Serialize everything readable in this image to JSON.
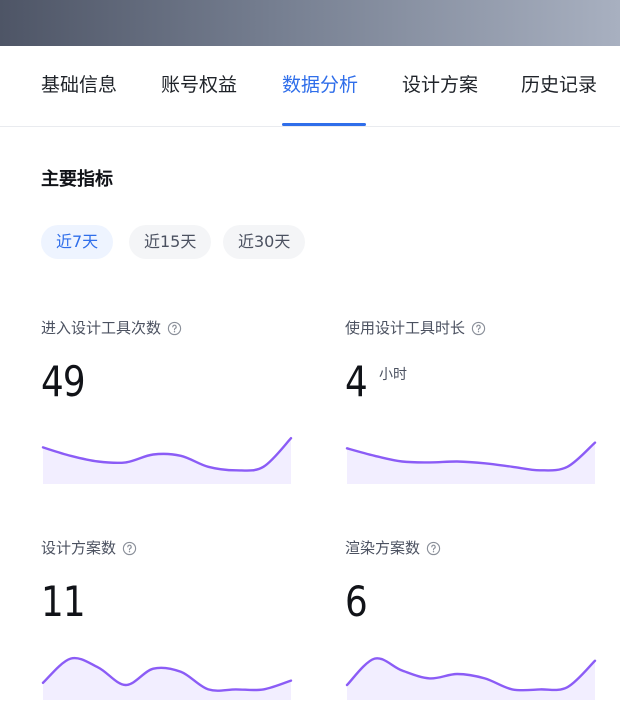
{
  "tabs": [
    {
      "label": "基础信息",
      "active": false
    },
    {
      "label": "账号权益",
      "active": false
    },
    {
      "label": "数据分析",
      "active": true
    },
    {
      "label": "设计方案",
      "active": false
    },
    {
      "label": "历史记录",
      "active": false
    }
  ],
  "section_title": "主要指标",
  "ranges": [
    {
      "label": "近7天",
      "active": true
    },
    {
      "label": "近15天",
      "active": false
    },
    {
      "label": "近30天",
      "active": false
    }
  ],
  "metrics": [
    {
      "label": "进入设计工具次数",
      "value": "49",
      "unit": "",
      "icon": "question-circle-icon",
      "trend": [
        0.74,
        0.55,
        0.42,
        0.4,
        0.58,
        0.55,
        0.3,
        0.22,
        0.3,
        0.95
      ]
    },
    {
      "label": "使用设计工具时长",
      "value": "4",
      "unit": "小时",
      "icon": "question-circle-icon",
      "trend": [
        0.72,
        0.55,
        0.42,
        0.4,
        0.42,
        0.38,
        0.3,
        0.22,
        0.3,
        0.85
      ]
    },
    {
      "label": "设计方案数",
      "value": "11",
      "unit": "",
      "icon": "question-circle-icon",
      "trend": [
        0.3,
        0.85,
        0.65,
        0.25,
        0.62,
        0.55,
        0.15,
        0.15,
        0.15,
        0.35
      ]
    },
    {
      "label": "渲染方案数",
      "value": "6",
      "unit": "",
      "icon": "question-circle-icon",
      "trend": [
        0.25,
        0.85,
        0.58,
        0.4,
        0.5,
        0.4,
        0.15,
        0.15,
        0.2,
        0.8
      ]
    }
  ],
  "colors": {
    "accent": "#2f6eea",
    "chip_bg": "#f4f5f7",
    "chip_active_bg": "#eef4ff",
    "spark_line": "#8b5cf6"
  }
}
